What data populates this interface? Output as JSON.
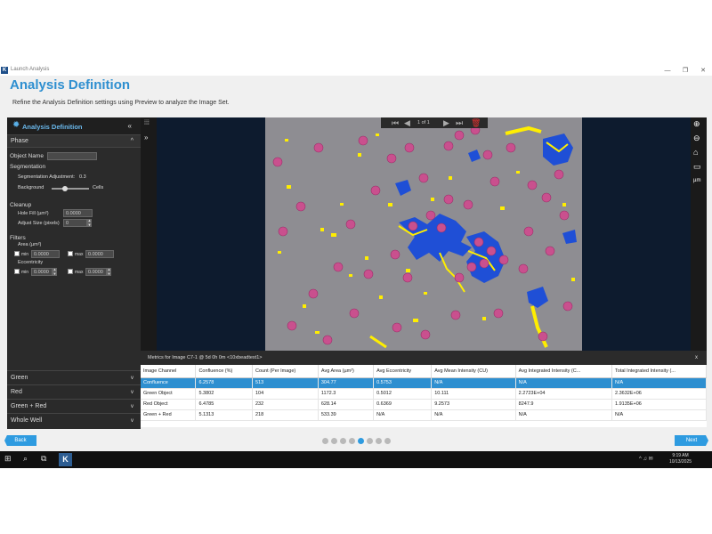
{
  "window": {
    "title": "Launch Analysis",
    "app_icon": "K",
    "minimize": "—",
    "maximize": "❐",
    "close": "✕"
  },
  "header": {
    "title": "Analysis Definition",
    "subtitle": "Refine the Analysis Definition settings using Preview to analyze the Image Set."
  },
  "left_panel": {
    "title": "Analysis Definition",
    "collapse_label": "«",
    "phase": {
      "label": "Phase",
      "chevron": "^"
    },
    "object_name": {
      "label": "Object Name",
      "value": ""
    },
    "segmentation": {
      "label": "Segmentation",
      "adjustment_label": "Segmentation Adjustment:",
      "adjustment_value": "0.3",
      "adjustment_fraction": 0.35,
      "background_label": "Background",
      "cells_label": "Cells"
    },
    "cleanup": {
      "label": "Cleanup",
      "hole_fill_label": "Hole Fill (µm²)",
      "hole_fill_value": "0.0000",
      "adjust_size_label": "Adjust Size (pixels)",
      "adjust_size_value": "0"
    },
    "filters": {
      "label": "Filters",
      "area_label": "Area (µm²)",
      "area_min_label": "min",
      "area_min_value": "0.0000",
      "area_max_label": "max",
      "area_max_value": "0.0000",
      "eccentricity_label": "Eccentricity",
      "ecc_min_label": "min",
      "ecc_min_value": "0.0000",
      "ecc_max_label": "max",
      "ecc_max_value": "0.0000"
    },
    "bottom_items": [
      {
        "label": "Green",
        "chevron": "v"
      },
      {
        "label": "Red",
        "chevron": "v"
      },
      {
        "label": "Green + Red",
        "chevron": "v"
      },
      {
        "label": "Whole Well",
        "chevron": "v"
      }
    ]
  },
  "viewer": {
    "page_indicator": "1   of 1",
    "left_tools": [
      "⁞⁞⁞",
      "»"
    ],
    "right_tools": [
      "⊕",
      "⊖",
      "⌂",
      "▭",
      "µm"
    ]
  },
  "metrics": {
    "title": "Metrics for Image C7-1 @ 5d 0h 0m <10xbeadtest1>",
    "close": "x",
    "columns": [
      "Image Channel",
      "Confluence (%)",
      "Count (Per Image)",
      "Avg Area (µm²)",
      "Avg Eccentricity",
      "Avg Mean Intensity (CU)",
      "Avg Integrated Intensity (C...",
      "Total Integrated Intensity (..."
    ],
    "rows": [
      [
        "Confluence",
        "6.2578",
        "513",
        "304.77",
        "0.5753",
        "N/A",
        "N/A",
        "N/A"
      ],
      [
        "Green Object",
        "5.3802",
        "104",
        "1172.3",
        "0.5012",
        "10.111",
        "2.2723E+04",
        "2.3632E+06"
      ],
      [
        "Red Object",
        "6.4785",
        "232",
        "628.14",
        "0.6369",
        "9.2573",
        "8247.9",
        "1.9135E+06"
      ],
      [
        "Green + Red",
        "5.1313",
        "218",
        "533.39",
        "N/A",
        "N/A",
        "N/A",
        "N/A"
      ]
    ],
    "selected_row": 0
  },
  "footer": {
    "back_label": "Back",
    "next_label": "Next",
    "step_count": 8,
    "active_step": 4
  },
  "taskbar": {
    "start_icon": "⊞",
    "search_icon": "⌕",
    "taskview_icon": "⧉",
    "app_label": "K",
    "time": "9:19 AM",
    "date": "10/13/2025",
    "tray": "^  ♫  ✉"
  },
  "colors": {
    "accent": "#2e9be0",
    "title_blue": "#2e8fd0",
    "panel_dark": "#2b2b2b",
    "green_object": "#ffee00",
    "red_object": "#c9508e",
    "overlap": "#1f4fd6"
  }
}
